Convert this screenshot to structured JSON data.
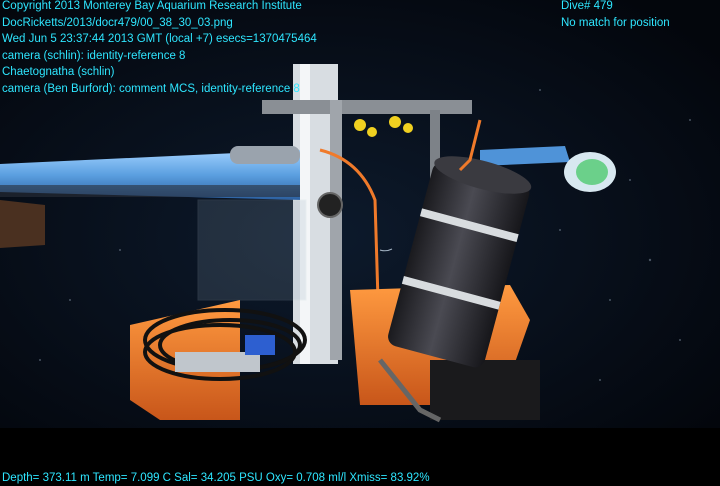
{
  "overlay_top_left": [
    "Copyright 2013 Monterey Bay Aquarium Research Institute",
    "DocRicketts/2013/docr479/00_38_30_03.png",
    "Wed Jun  5 23:37:44 2013 GMT (local +7)  esecs=1370475464",
    "camera (schlin): identity-reference 8",
    "Chaetognatha (schlin)",
    "camera (Ben Burford): comment MCS, identity-reference 8"
  ],
  "overlay_top_right": [
    "Dive# 479",
    "No match for position"
  ],
  "overlay_bottom": "Depth= 373.11 m  Temp= 7.099 C  Sal= 34.205 PSU  Oxy= 0.708 ml/l  Xmiss= 83.92%",
  "colors": {
    "overlay_text": "#2ee6ff",
    "water": "#05080f",
    "orange_frame": "#f07a2a",
    "blue_pole": "#5aa8e8",
    "canister": "#2a2a2e"
  }
}
